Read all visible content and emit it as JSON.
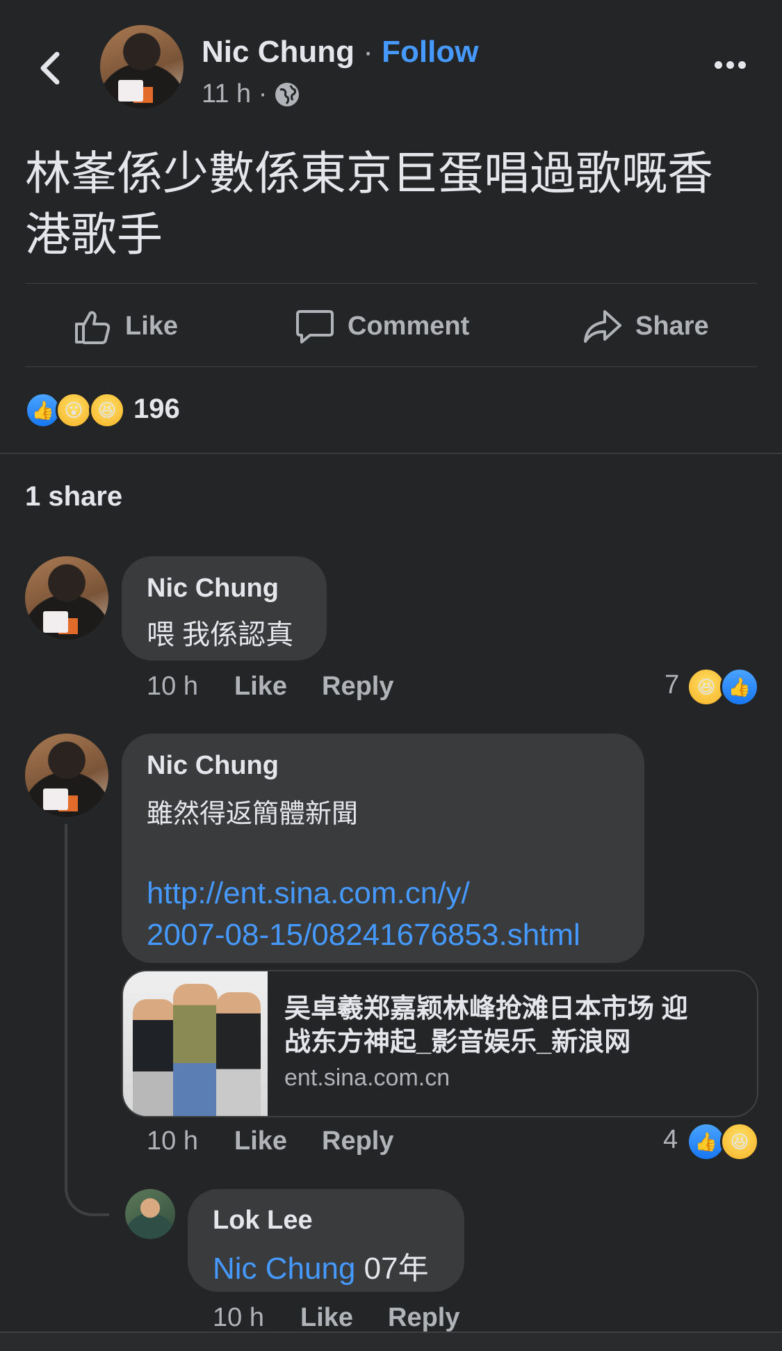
{
  "post": {
    "author": "Nic Chung",
    "separator": "·",
    "follow_label": "Follow",
    "time": "11 h ·",
    "audience_icon": "globe-icon",
    "text_line1": "林峯係少數係東京巨蛋唱過歌嘅香",
    "text_line2": "港歌手",
    "actions": {
      "like": "Like",
      "comment": "Comment",
      "share": "Share"
    },
    "reaction_count": "196",
    "shares": "1 share"
  },
  "comments": [
    {
      "author": "Nic Chung",
      "text": "喂 我係認真",
      "time": "10 h",
      "like": "Like",
      "reply": "Reply",
      "reaction_count": "7"
    },
    {
      "author": "Nic Chung",
      "text": "雖然得返簡體新聞",
      "url_line1": "http://ent.sina.com.cn/y/",
      "url_line2": "2007-08-15/08241676853.shtml",
      "preview_title_line1": "吴卓羲郑嘉颖林峰抢滩日本市场 迎",
      "preview_title_line2": "战东方神起_影音娱乐_新浪网",
      "preview_domain": "ent.sina.com.cn",
      "time": "10 h",
      "like": "Like",
      "reply": "Reply",
      "reaction_count": "4"
    }
  ],
  "reply": {
    "author": "Lok Lee",
    "mention": "Nic Chung",
    "text": "07年",
    "time": "10 h",
    "like": "Like",
    "reply": "Reply"
  },
  "colors": {
    "background": "#242526",
    "accent": "#4599ff",
    "bubble": "#3a3b3c"
  }
}
